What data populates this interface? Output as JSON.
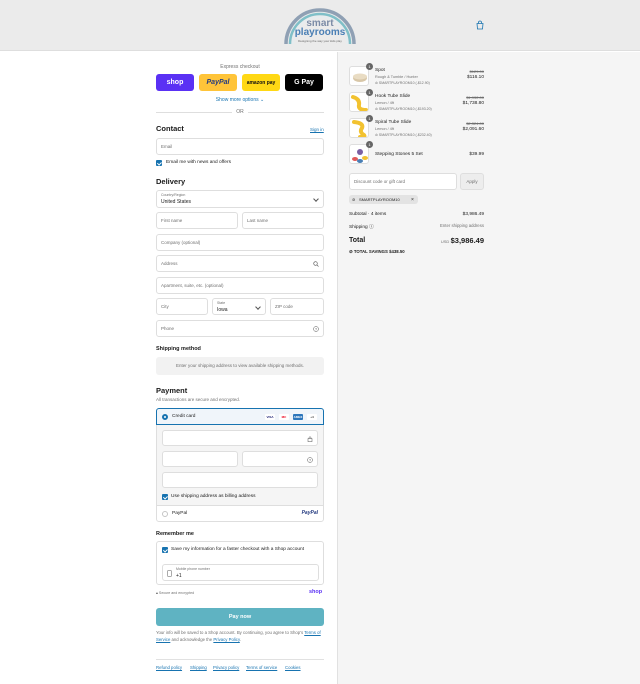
{
  "brand": {
    "line1": "smart",
    "line2": "playrooms",
    "tagline": "Designing the way your kids play"
  },
  "express": {
    "label": "Express checkout",
    "buttons": [
      "shop",
      "PayPal",
      "amazon pay",
      "G Pay"
    ],
    "show_more": "Show more options",
    "or": "OR"
  },
  "contact": {
    "title": "Contact",
    "sign_in": "Sign in",
    "email_placeholder": "Email",
    "news_label": "Email me with news and offers"
  },
  "delivery": {
    "title": "Delivery",
    "country_label": "Country/Region",
    "country_value": "United States",
    "first_name": "First name",
    "last_name": "Last name",
    "company": "Company (optional)",
    "address": "Address",
    "apartment": "Apartment, suite, etc. (optional)",
    "city": "City",
    "state_label": "State",
    "state_value": "Iowa",
    "zip": "ZIP code",
    "phone": "Phone"
  },
  "shipping_method": {
    "title": "Shipping method",
    "message": "Enter your shipping address to view available shipping methods."
  },
  "payment": {
    "title": "Payment",
    "subtitle": "All transactions are secure and encrypted.",
    "credit_card": "Credit card",
    "card_logos": [
      "VISA",
      "MC",
      "AMEX",
      "+4"
    ],
    "billing_same": "Use shipping address as billing address",
    "paypal": "PayPal",
    "paypal_logo": "PayPal"
  },
  "remember": {
    "title": "Remember me",
    "save_label": "Save my information for a faster checkout with a Shop account",
    "mobile_label": "Mobile phone number",
    "mobile_value": "+1",
    "secure": "Secure and encrypted",
    "shop": "shop"
  },
  "pay_now": "Pay now",
  "legal": {
    "text1": "Your info will be saved to a Shop account. By continuing, you agree to Shop's",
    "tos": "Terms of Service",
    "text2": "and acknowledge the",
    "privacy": "Privacy Policy",
    "end": "."
  },
  "footer_links": [
    "Refund policy",
    "Shipping",
    "Privacy policy",
    "Terms of service",
    "Cookies"
  ],
  "order": {
    "items": [
      {
        "qty": "1",
        "name": "Spot",
        "variant": "Rough & Tumble / Hunter",
        "discount": "SMARTPLAYROOM10 (-$12.90)",
        "compare": "$129.00",
        "price": "$116.10"
      },
      {
        "qty": "1",
        "name": "Hook Tube Slide",
        "variant": "Lemon / 4ft",
        "discount": "SMARTPLAYROOM10 (-$193.20)",
        "compare": "$1,932.00",
        "price": "$1,738.80"
      },
      {
        "qty": "1",
        "name": "Spiral Tube Slide",
        "variant": "Lemon / 4ft",
        "discount": "SMARTPLAYROOM10 (-$232.40)",
        "compare": "$2,324.00",
        "price": "$2,091.60"
      },
      {
        "qty": "1",
        "name": "Stepping Stones 5 Set",
        "variant": "",
        "discount": "",
        "compare": "",
        "price": "$39.99"
      }
    ],
    "discount_placeholder": "Discount code or gift card",
    "apply": "Apply",
    "applied_code": "SMARTPLAYROOM10",
    "subtotal_label": "Subtotal · 4 items",
    "subtotal_value": "$3,986.49",
    "shipping_label": "Shipping",
    "shipping_value": "Enter shipping address",
    "total_label": "Total",
    "currency": "USD",
    "total_value": "$3,986.49",
    "savings_label": "TOTAL SAVINGS",
    "savings_value": "$438.50"
  },
  "colors": {
    "accent": "#1773b0",
    "pay_button": "#5fb3c2",
    "header_bg": "#ebebeb",
    "summary_bg": "#f5f5f5"
  }
}
